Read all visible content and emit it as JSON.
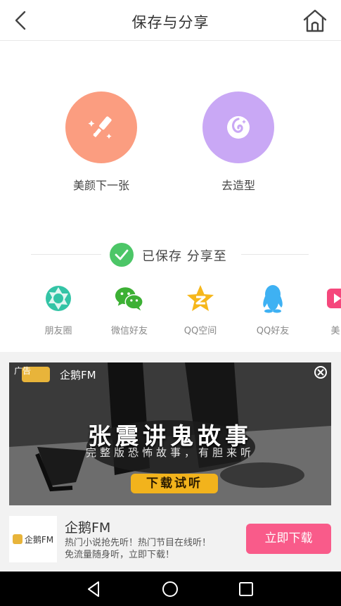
{
  "header": {
    "title": "保存与分享",
    "back_icon": "chevron-left-icon",
    "home_icon": "home-icon"
  },
  "actions": [
    {
      "label": "美颜下一张",
      "icon": "magic-wand-icon",
      "color": "#fb9d80"
    },
    {
      "label": "去造型",
      "icon": "style-swirl-icon",
      "color": "#c9a8f5"
    }
  ],
  "saved": {
    "text": "已保存 分享至",
    "color": "#4cc667"
  },
  "share": [
    {
      "label": "朋友圈",
      "icon": "moments-shutter-icon",
      "color": "#33c4a6"
    },
    {
      "label": "微信好友",
      "icon": "wechat-icon",
      "color": "#3cb034"
    },
    {
      "label": "QQ空间",
      "icon": "qzone-star-icon",
      "color": "#f6b71b"
    },
    {
      "label": "QQ好友",
      "icon": "qq-penguin-icon",
      "color": "#3eb1f3"
    },
    {
      "label": "美",
      "icon": "meipai-icon",
      "color": "#f5477c"
    }
  ],
  "ad": {
    "tag": "广告",
    "brand": "企鹅FM",
    "headline": "张震讲鬼故事",
    "subline": "完整版恐怖故事，有胆来听",
    "cta": "下载试听",
    "icon_text": "企鹅FM",
    "title": "企鹅FM",
    "desc_line1": "热门小说抢先听！热门节目在线听！",
    "desc_line2": "免流量随身听，立即下载！",
    "download": "立即下载",
    "download_color": "#f95b8a"
  },
  "navbar": {
    "back_icon": "triangle-back-icon",
    "home_icon": "circle-home-icon",
    "recents_icon": "square-recents-icon"
  }
}
